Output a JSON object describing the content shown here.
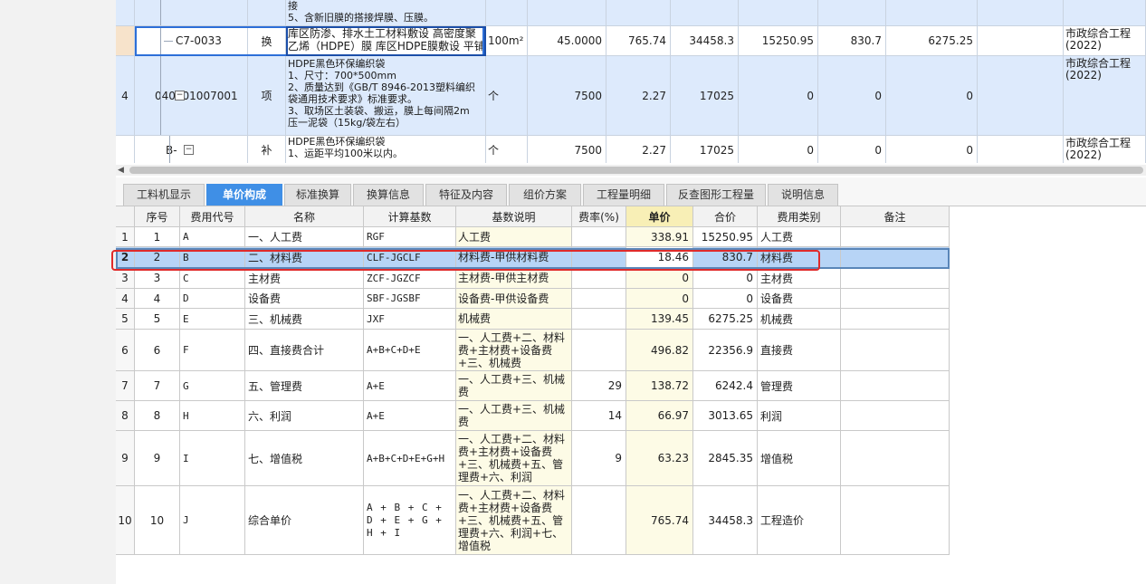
{
  "top_rows": [
    {
      "row_no": "",
      "code": "",
      "type": "",
      "desc_lines": [
        "接",
        "5、含新旧膜的搭接焊膜、压膜。"
      ],
      "unit": "",
      "qty": "",
      "price": "",
      "total": "",
      "f1": "",
      "f2": "",
      "f3": "",
      "category": ""
    },
    {
      "row_no": "",
      "code": "C7-0033",
      "type": "换",
      "desc_lines": [
        "库区防渗、排水土工材料敷设 高密度聚",
        "乙烯（HDPE）膜 库区HDPE膜敷设 平铺"
      ],
      "unit": "100m²",
      "qty": "45.0000",
      "price": "765.74",
      "total": "34458.3",
      "f1": "15250.95",
      "f2": "830.7",
      "f3": "6275.25",
      "category": "市政综合工程\n(2022)"
    },
    {
      "row_no": "4",
      "code": "040701007001",
      "type": "项",
      "desc_lines": [
        "HDPE黑色环保编织袋",
        "1、尺寸：700*500mm",
        "2、质量达到《GB/T 8946-2013塑料编织",
        "袋通用技术要求》标准要求。",
        "3、取场区土装袋、搬运，膜上每间隔2m",
        "压一泥袋（15kg/袋左右）"
      ],
      "unit": "个",
      "qty": "7500",
      "price": "2.27",
      "total": "17025",
      "f1": "0",
      "f2": "0",
      "f3": "0",
      "category": "市政综合工程\n(2022)"
    },
    {
      "row_no": "",
      "code": "B-",
      "type": "补",
      "desc_lines": [
        "HDPE黑色环保编织袋",
        "1、运距平均100米以内。"
      ],
      "unit": "个",
      "qty": "7500",
      "price": "2.27",
      "total": "17025",
      "f1": "0",
      "f2": "0",
      "f3": "0",
      "category": "市政综合工程\n(2022)"
    }
  ],
  "tabs": [
    {
      "label": "工料机显示",
      "active": false
    },
    {
      "label": "单价构成",
      "active": true
    },
    {
      "label": "标准换算",
      "active": false
    },
    {
      "label": "换算信息",
      "active": false
    },
    {
      "label": "特征及内容",
      "active": false
    },
    {
      "label": "组价方案",
      "active": false
    },
    {
      "label": "工程量明细",
      "active": false
    },
    {
      "label": "反查图形工程量",
      "active": false
    },
    {
      "label": "说明信息",
      "active": false
    }
  ],
  "bottom_headers": [
    "",
    "序号",
    "费用代号",
    "名称",
    "计算基数",
    "基数说明",
    "费率(%)",
    "单价",
    "合价",
    "费用类别",
    "备注"
  ],
  "bottom_rows": [
    {
      "row_no": "1",
      "seq": "1",
      "code": "A",
      "name": "一、人工费",
      "base": "RGF",
      "base_desc": "人工费",
      "rate": "",
      "price": "338.91",
      "total": "15250.95",
      "category": "人工费",
      "note": ""
    },
    {
      "row_no": "2",
      "seq": "2",
      "code": "B",
      "name": "二、材料费",
      "base": "CLF-JGCLF",
      "base_desc": "材料费-甲供材料费",
      "rate": "",
      "price": "18.46",
      "total": "830.7",
      "category": "材料费",
      "note": ""
    },
    {
      "row_no": "3",
      "seq": "3",
      "code": "C",
      "name": "主材费",
      "base": "ZCF-JGZCF",
      "base_desc": "主材费-甲供主材费",
      "rate": "",
      "price": "0",
      "total": "0",
      "category": "主材费",
      "note": ""
    },
    {
      "row_no": "4",
      "seq": "4",
      "code": "D",
      "name": "设备费",
      "base": "SBF-JGSBF",
      "base_desc": "设备费-甲供设备费",
      "rate": "",
      "price": "0",
      "total": "0",
      "category": "设备费",
      "note": ""
    },
    {
      "row_no": "5",
      "seq": "5",
      "code": "E",
      "name": "三、机械费",
      "base": "JXF",
      "base_desc": "机械费",
      "rate": "",
      "price": "139.45",
      "total": "6275.25",
      "category": "机械费",
      "note": ""
    },
    {
      "row_no": "6",
      "seq": "6",
      "code": "F",
      "name": "四、直接费合计",
      "base": "A+B+C+D+E",
      "base_desc": "一、人工费+二、材料费+主材费+设备费+三、机械费",
      "rate": "",
      "price": "496.82",
      "total": "22356.9",
      "category": "直接费",
      "note": ""
    },
    {
      "row_no": "7",
      "seq": "7",
      "code": "G",
      "name": "五、管理费",
      "base": "A+E",
      "base_desc": "一、人工费+三、机械费",
      "rate": "29",
      "price": "138.72",
      "total": "6242.4",
      "category": "管理费",
      "note": ""
    },
    {
      "row_no": "8",
      "seq": "8",
      "code": "H",
      "name": "六、利润",
      "base": "A+E",
      "base_desc": "一、人工费+三、机械费",
      "rate": "14",
      "price": "66.97",
      "total": "3013.65",
      "category": "利润",
      "note": ""
    },
    {
      "row_no": "9",
      "seq": "9",
      "code": "I",
      "name": "七、增值税",
      "base": "A+B+C+D+E+G+H",
      "base_desc": "一、人工费+二、材料费+主材费+设备费+三、机械费+五、管理费+六、利润",
      "rate": "9",
      "price": "63.23",
      "total": "2845.35",
      "category": "增值税",
      "note": ""
    },
    {
      "row_no": "10",
      "seq": "10",
      "code": "J",
      "name": "综合单价",
      "base": "A + B + C + D + E + G + H + I",
      "base_desc": "一、人工费+二、材料费+主材费+设备费+三、机械费+五、管理费+六、利润+七、增值税",
      "rate": "",
      "price": "765.74",
      "total": "34458.3",
      "category": "工程造价",
      "note": ""
    }
  ],
  "colors": {
    "accent": "#3f8fe6",
    "selection": "#b7d4f6",
    "highlight_box": "#e02a2a",
    "price_header": "#f8efb6"
  }
}
